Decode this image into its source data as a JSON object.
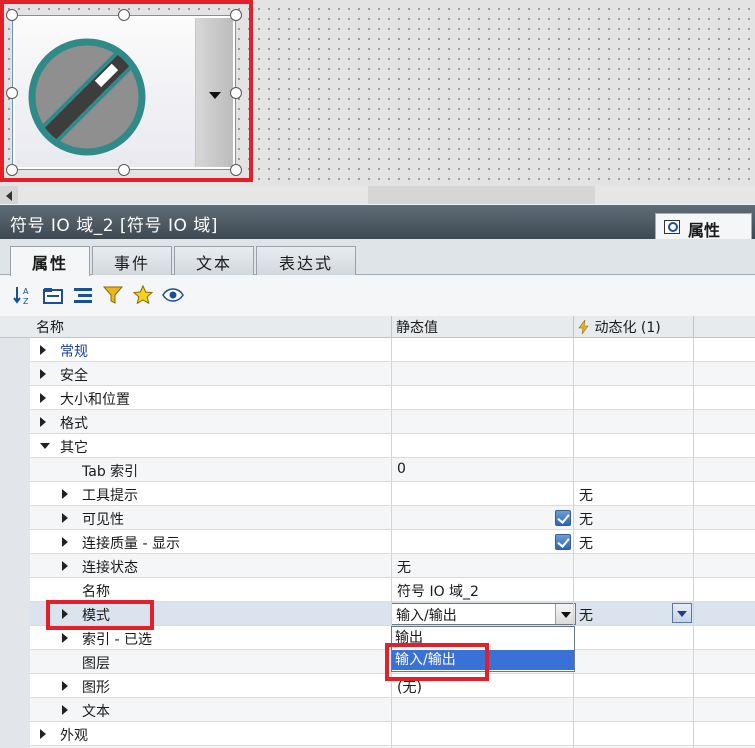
{
  "canvas": {
    "widget": {
      "name": "symbolic-io-field"
    },
    "icons": [
      "dial-icon",
      "dropdown-arrow-icon",
      "scroll-left-icon"
    ]
  },
  "inspector": {
    "title": "符号 IO 域_2 [符号 IO 域]",
    "panel_tab": {
      "label": "属性",
      "icon": "magnifier-icon"
    },
    "tabs": [
      {
        "label": "属性",
        "active": true
      },
      {
        "label": "事件",
        "active": false
      },
      {
        "label": "文本",
        "active": false
      },
      {
        "label": "表达式",
        "active": false
      }
    ],
    "toolbar": {
      "icons": [
        "sort-az-icon",
        "folder-view-icon",
        "list-view-icon",
        "filter-icon",
        "favorite-star-icon",
        "eye-icon"
      ]
    },
    "grid": {
      "columns": {
        "name": "名称",
        "static_value": "静态值",
        "dynamic": "动态化 (1)"
      },
      "rows": [
        {
          "label": "常规",
          "level": 0,
          "expander": "right",
          "value": "",
          "dynamic": "",
          "link": true
        },
        {
          "label": "安全",
          "level": 0,
          "expander": "right",
          "value": "",
          "dynamic": ""
        },
        {
          "label": "大小和位置",
          "level": 0,
          "expander": "right",
          "value": "",
          "dynamic": ""
        },
        {
          "label": "格式",
          "level": 0,
          "expander": "right",
          "value": "",
          "dynamic": ""
        },
        {
          "label": "其它",
          "level": 0,
          "expander": "down",
          "value": "",
          "dynamic": ""
        },
        {
          "label": "Tab 索引",
          "level": 2,
          "expander": "none",
          "value": "0",
          "dynamic": ""
        },
        {
          "label": "工具提示",
          "level": 1,
          "expander": "right",
          "value": "",
          "dynamic": "无"
        },
        {
          "label": "可见性",
          "level": 1,
          "expander": "right",
          "value": "",
          "dynamic": "无",
          "checked": true
        },
        {
          "label": "连接质量 - 显示",
          "level": 1,
          "expander": "right",
          "value": "",
          "dynamic": "无",
          "checked": true
        },
        {
          "label": "连接状态",
          "level": 1,
          "expander": "right",
          "value": "无",
          "dynamic": ""
        },
        {
          "label": "名称",
          "level": 2,
          "expander": "none",
          "value": "符号 IO 域_2",
          "dynamic": ""
        },
        {
          "label": "模式",
          "level": 1,
          "expander": "right",
          "value": "输入/输出",
          "dynamic": "无",
          "combo": true
        },
        {
          "label": "索引 - 已选",
          "level": 1,
          "expander": "right",
          "value": "",
          "dynamic": ""
        },
        {
          "label": "图层",
          "level": 2,
          "expander": "none",
          "value": "",
          "dynamic": ""
        },
        {
          "label": "图形",
          "level": 1,
          "expander": "right",
          "value": "(无)",
          "dynamic": ""
        },
        {
          "label": "文本",
          "level": 1,
          "expander": "right",
          "value": "",
          "dynamic": ""
        },
        {
          "label": "外观",
          "level": 0,
          "expander": "right",
          "value": "",
          "dynamic": ""
        }
      ],
      "mode_dropdown": {
        "options": [
          "输出",
          "输入/输出"
        ],
        "highlighted": "输入/输出"
      }
    }
  },
  "colors": {
    "highlight_red": "#e3202a",
    "selection_blue": "#3a71d6",
    "title_bar": "#4b5761"
  }
}
